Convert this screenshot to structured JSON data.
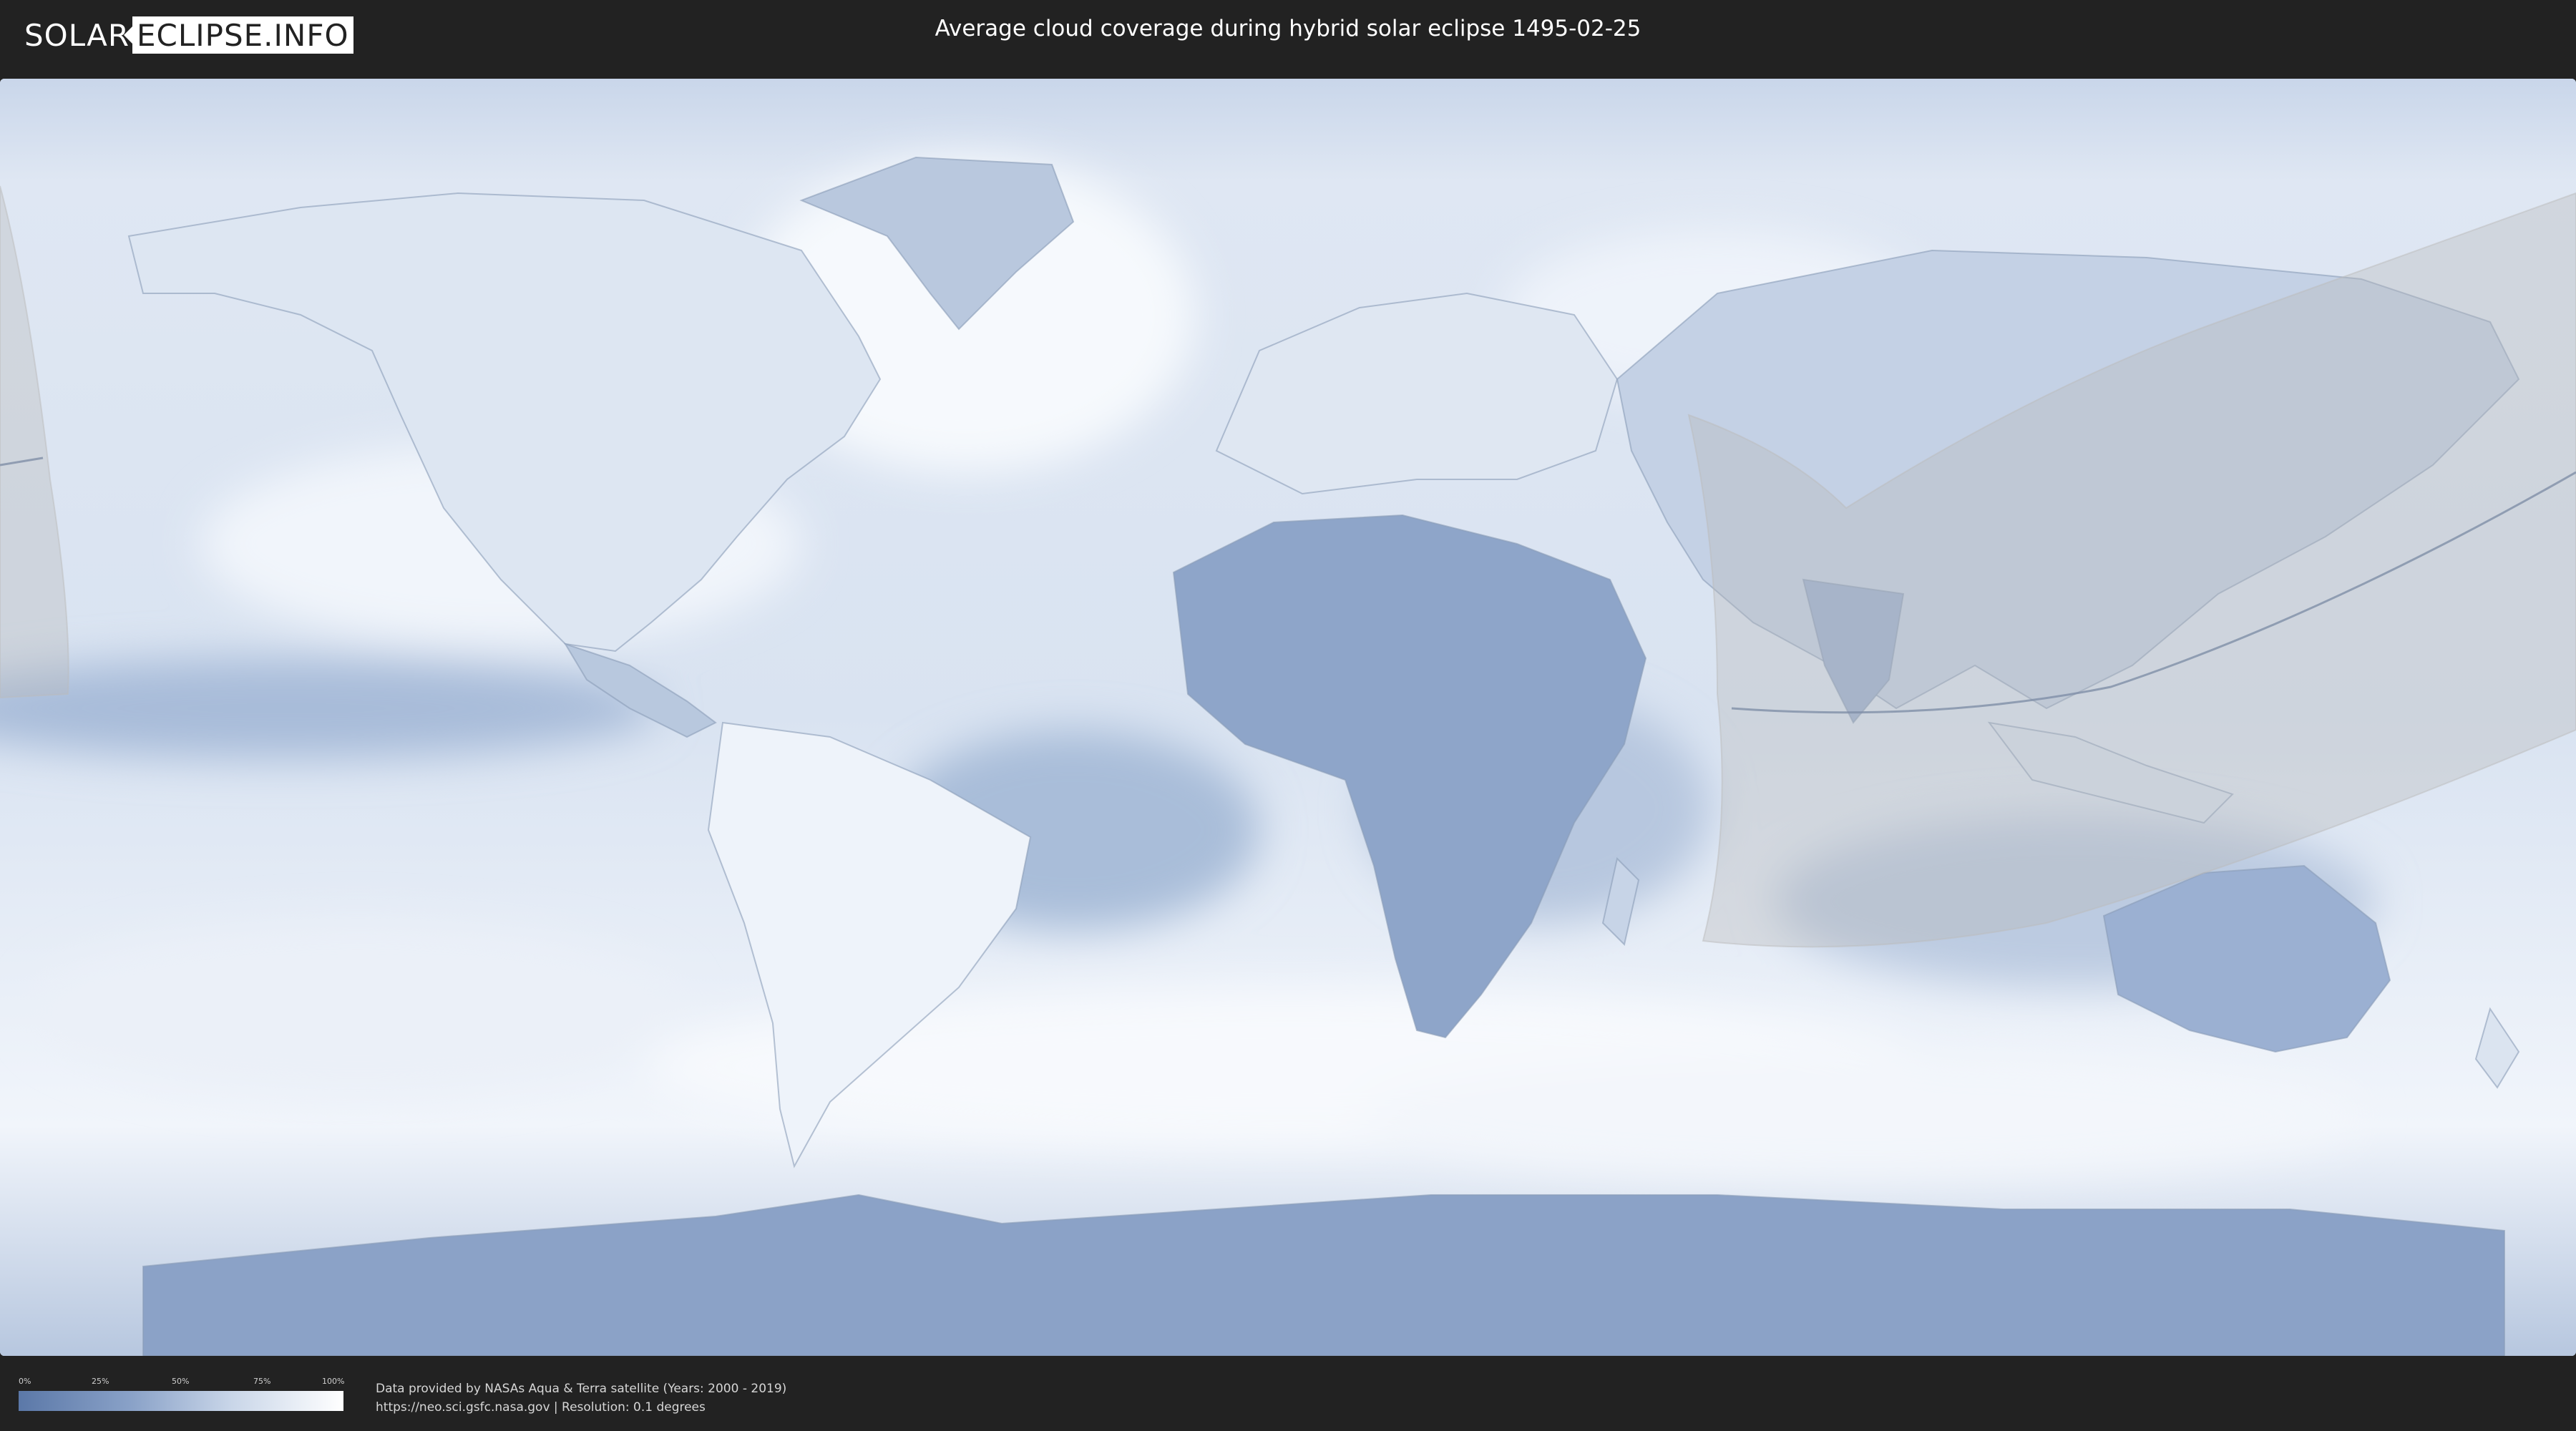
{
  "header": {
    "logo_part1": "SOLAR",
    "logo_part2": "ECLIPSE.INFO",
    "title": "Average cloud coverage during hybrid solar eclipse 1495-02-25"
  },
  "legend": {
    "ticks": [
      "0%",
      "25%",
      "50%",
      "75%",
      "100%"
    ],
    "colors": {
      "low": "#5b78a8",
      "high": "#ffffff"
    }
  },
  "footer": {
    "credit_line1": "Data provided by NASAs Aqua & Terra satellite (Years: 2000 - 2019)",
    "credit_line2": "https://neo.sci.gsfc.nasa.gov | Resolution: 0.1 degrees"
  },
  "map": {
    "colors": {
      "ocean_cloud": "#e7eef8",
      "clear": "#6f8bb8",
      "land_edge": "#8a9cb8",
      "shadow": "#b8b8b8"
    }
  }
}
